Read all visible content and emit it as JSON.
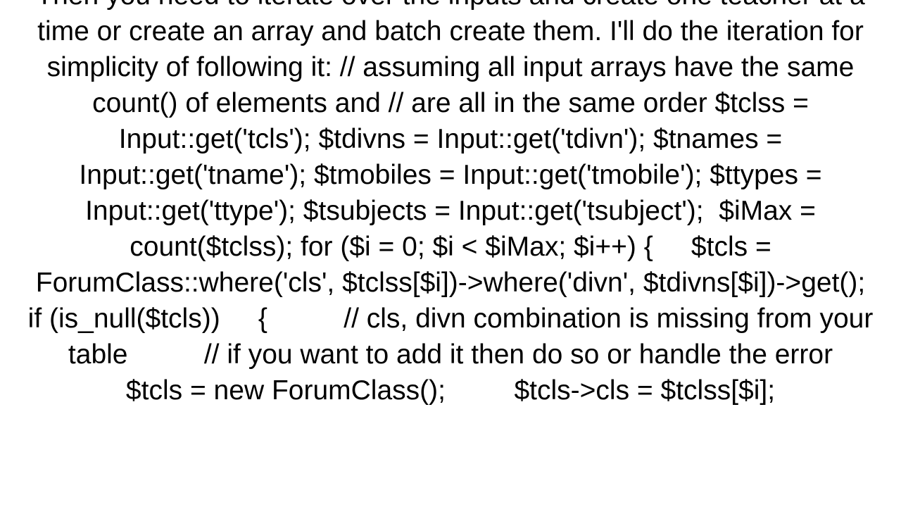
{
  "body": "Then you need to iterate over the inputs and create one teacher at a time or create an array and batch create them. I'll do the iteration for simplicity of following it: // assuming all input arrays have the same count() of elements and // are all in the same order $tclss = Input::get('tcls'); $tdivns = Input::get('tdivn'); $tnames = Input::get('tname'); $tmobiles = Input::get('tmobile'); $ttypes = Input::get('ttype'); $tsubjects = Input::get('tsubject');  $iMax = count($tclss); for ($i = 0; $i < $iMax; $i++) {     $tcls = ForumClass::where('cls', $tclss[$i])->where('divn', $tdivns[$i])->get();     if (is_null($tcls))     {          // cls, divn combination is missing from your table          // if you want to add it then do so or handle the error         $tcls = new ForumClass();         $tcls->cls = $tclss[$i];"
}
